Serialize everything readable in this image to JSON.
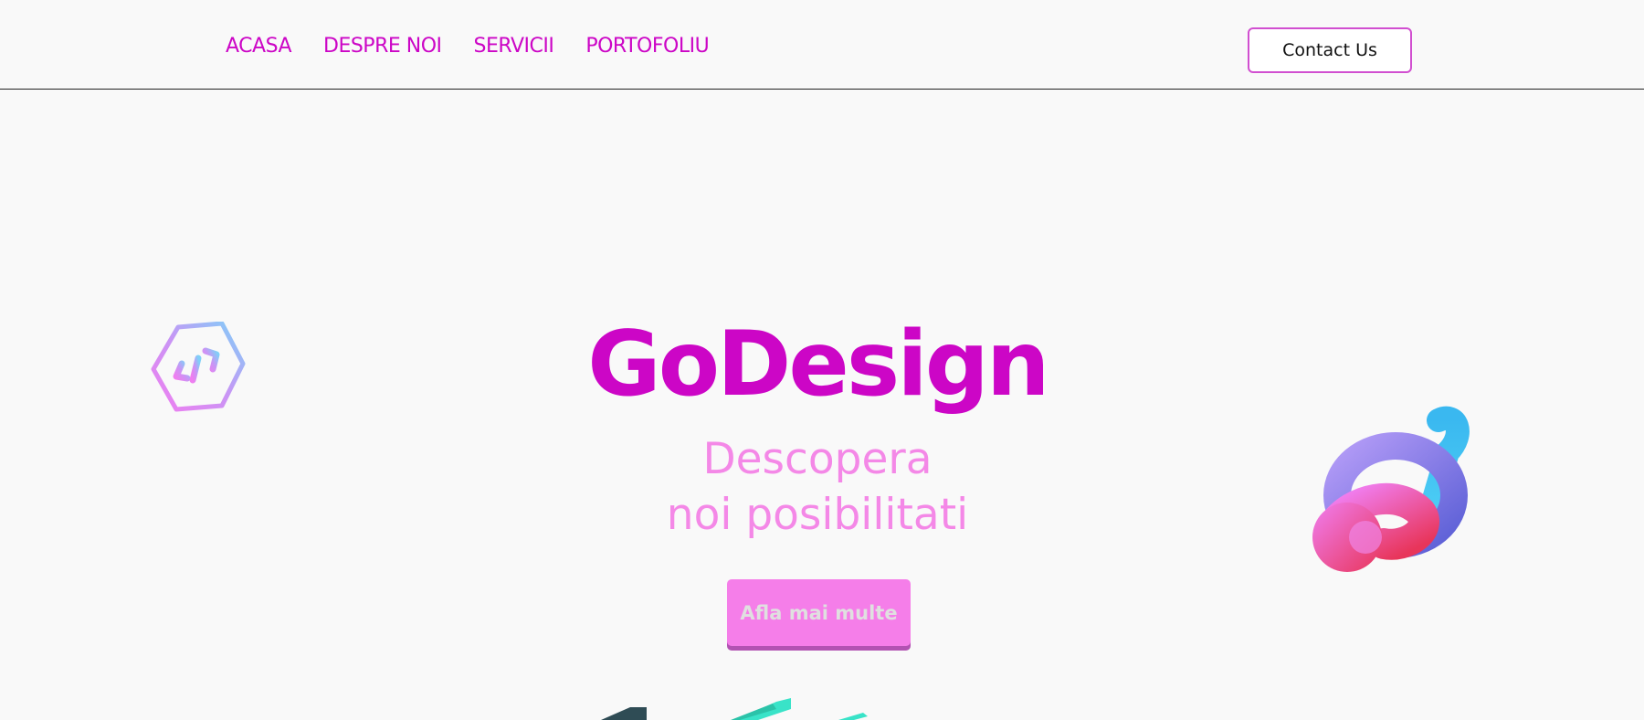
{
  "nav": {
    "links": [
      "ACASA",
      "DESPRE NOI",
      "SERVICII",
      "PORTOFOLIU"
    ],
    "contact_label": "Contact Us"
  },
  "hero": {
    "title": "GoDesign",
    "subtitle_line1": "Descopera",
    "subtitle_line2": "noi posibilitati",
    "cta_label": "Afla mai multe"
  },
  "colors": {
    "primary": "#cc06c6",
    "accent": "#f488e7",
    "cta": "#f57ee9",
    "background": "#f9f9f9"
  },
  "icons": [
    "code-hexagon-icon",
    "3d-knot-graphic",
    "3d-shapes-graphic"
  ]
}
